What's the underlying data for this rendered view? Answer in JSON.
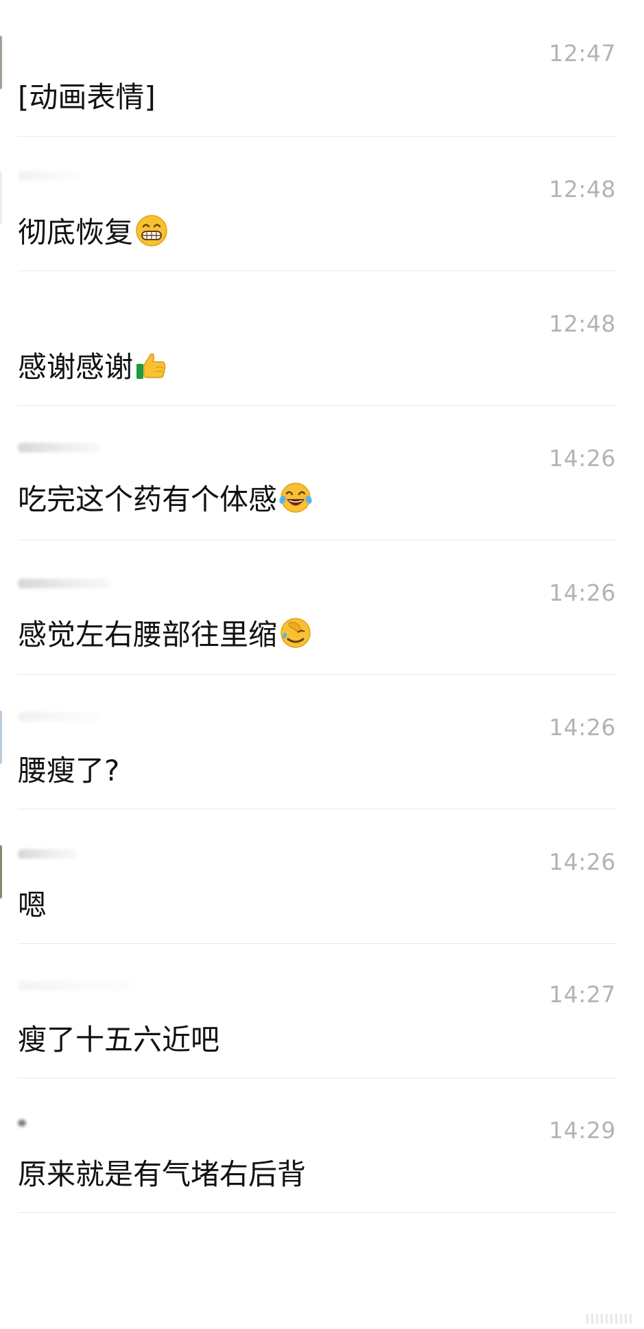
{
  "messages": [
    {
      "time": "12:47",
      "text": "[动画表情]",
      "emoji": null
    },
    {
      "time": "12:48",
      "text": "彻底恢复",
      "emoji": "grinning-face-icon"
    },
    {
      "time": "12:48",
      "text": "感谢感谢",
      "emoji": "thumbs-up-icon"
    },
    {
      "time": "14:26",
      "text": "吃完这个药有个体感",
      "emoji": "tears-of-joy-icon"
    },
    {
      "time": "14:26",
      "text": "感觉左右腰部往里缩",
      "emoji": "facepalm-icon"
    },
    {
      "time": "14:26",
      "text": "腰瘦了?",
      "emoji": null
    },
    {
      "time": "14:26",
      "text": "嗯",
      "emoji": null
    },
    {
      "time": "14:27",
      "text": "瘦了十五六近吧",
      "emoji": null
    },
    {
      "time": "14:29",
      "text": "原来就是有气堵右后背",
      "emoji": null
    }
  ],
  "colors": {
    "text": "#111111",
    "time": "#b3b3b3",
    "divider": "#e8e8e8",
    "background": "#ffffff"
  }
}
